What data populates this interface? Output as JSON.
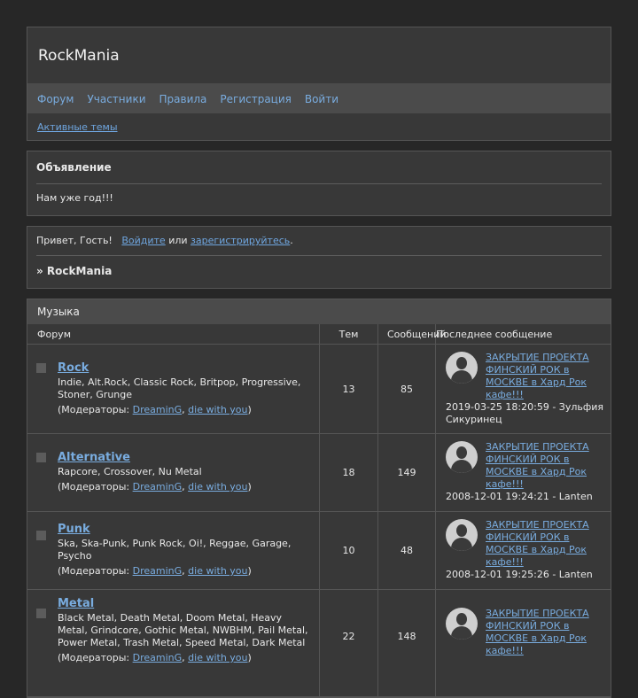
{
  "site": {
    "title": "RockMania"
  },
  "nav": {
    "items": [
      "Форум",
      "Участники",
      "Правила",
      "Регистрация",
      "Войти"
    ]
  },
  "subnav": {
    "active_topics": "Активные темы"
  },
  "announcement": {
    "title": "Объявление",
    "text": "Нам уже год!!!"
  },
  "welcome": {
    "greeting": "Привет, Гость!",
    "login": "Войдите",
    "or": "или",
    "register": "зарегистрируйтесь",
    "dot": ".",
    "breadcrumb": "» RockMania"
  },
  "category": {
    "name": "Музыка",
    "headers": {
      "forum": "Форум",
      "topics": "Тем",
      "posts": "Сообщений",
      "last": "Последнее сообщение"
    },
    "moderators_label": "(Модераторы:",
    "close_paren": ")",
    "comma": ",",
    "forums": [
      {
        "name": "Rock",
        "desc": "Indie, Alt.Rock, Classic Rock, Britpop, Progressive, Stoner, Grunge",
        "mods": [
          "DreaminG",
          "die with you"
        ],
        "topics": "13",
        "posts": "85",
        "last_title": "ЗАКРЫТИЕ ПРОЕКТА ФИНСКИЙ РОК в МОСКВЕ в Хард Рок кафе!!!",
        "last_info": "2019-03-25 18:20:59 - Зульфия Сикуринец"
      },
      {
        "name": "Alternative",
        "desc": "Rapcore, Crossover, Nu Metal",
        "mods": [
          "DreaminG",
          "die with you"
        ],
        "topics": "18",
        "posts": "149",
        "last_title": "ЗАКРЫТИЕ ПРОЕКТА ФИНСКИЙ РОК в МОСКВЕ в Хард Рок кафе!!!",
        "last_info": "2008-12-01 19:24:21 - Lanten"
      },
      {
        "name": "Punk",
        "desc": "Ska, Ska-Punk, Punk Rock, Oi!, Reggae, Garage, Psycho",
        "mods": [
          "DreaminG",
          "die with you"
        ],
        "topics": "10",
        "posts": "48",
        "last_title": "ЗАКРЫТИЕ ПРОЕКТА ФИНСКИЙ РОК в МОСКВЕ в Хард Рок кафе!!!",
        "last_info": "2008-12-01 19:25:26 - Lanten"
      },
      {
        "name": "Metal",
        "desc": "Black Metal, Death Metal, Doom Metal, Heavy Metal, Grindcore, Gothic Metal, NWBHM, Pail Metal, Power Metal, Trash Metal, Speed Metal, Dark Metal",
        "mods": [
          "DreaminG",
          "die with you"
        ],
        "topics": "22",
        "posts": "148",
        "last_title": "ЗАКРЫТИЕ ПРОЕКТА ФИНСКИЙ РОК в МОСКВЕ в Хард Рок кафе!!!",
        "last_info": ""
      }
    ]
  }
}
